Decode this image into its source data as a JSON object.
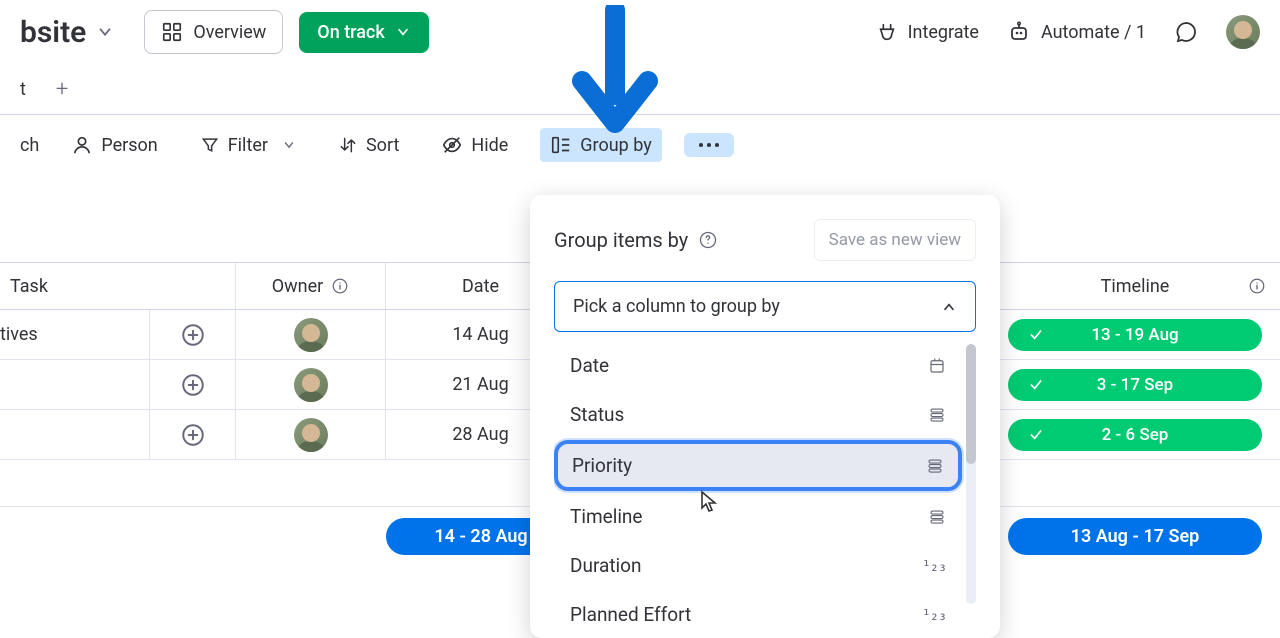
{
  "header": {
    "board_title": "bsite",
    "overview_label": "Overview",
    "status_label": "On track",
    "integrate_label": "Integrate",
    "automate_label": "Automate / 1"
  },
  "tabs": {
    "first_visible": "t",
    "add": "+"
  },
  "toolbar": {
    "search": "ch",
    "person": "Person",
    "filter": "Filter",
    "sort": "Sort",
    "hide": "Hide",
    "group_by": "Group by"
  },
  "table": {
    "columns": {
      "task": "Task",
      "owner": "Owner",
      "date": "Date",
      "timeline": "Timeline"
    },
    "rows": [
      {
        "task": "tives",
        "date": "14 Aug",
        "timeline": "13 - 19 Aug"
      },
      {
        "task": "",
        "date": "21 Aug",
        "timeline": "3 - 17 Sep"
      },
      {
        "task": "",
        "date": "28 Aug",
        "timeline": "2 - 6 Sep"
      }
    ],
    "summary": {
      "date_range": "14 - 28 Aug",
      "timeline_range": "13 Aug - 17 Sep"
    }
  },
  "popover": {
    "title": "Group items by",
    "save_view": "Save as new view",
    "select_placeholder": "Pick a column to group by",
    "options": [
      {
        "label": "Date",
        "type": "date"
      },
      {
        "label": "Status",
        "type": "status"
      },
      {
        "label": "Priority",
        "type": "status",
        "highlighted": true
      },
      {
        "label": "Timeline",
        "type": "status"
      },
      {
        "label": "Duration",
        "type": "number"
      },
      {
        "label": "Planned Effort",
        "type": "number"
      }
    ]
  }
}
